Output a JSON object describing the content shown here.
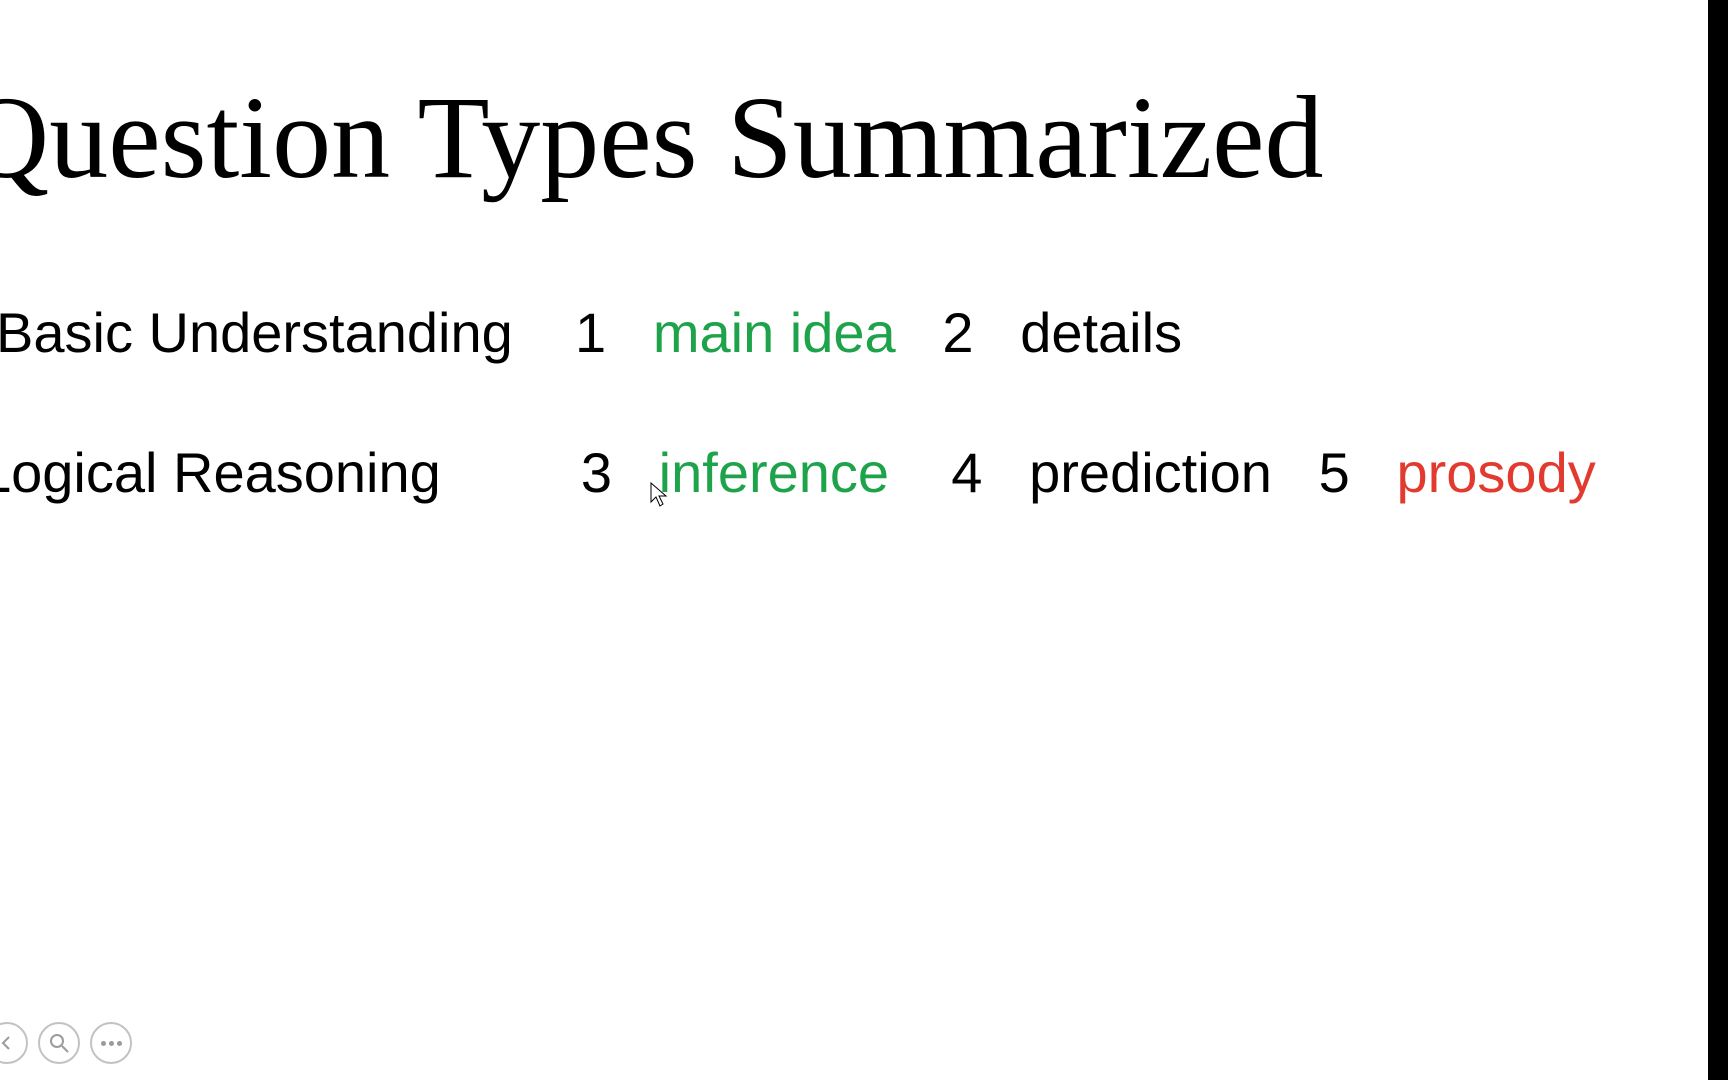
{
  "title": "Question Types Summarized",
  "line1": {
    "category": "Basic Understanding",
    "n1": "1",
    "t1": "main idea",
    "n2": "2",
    "t2": "details"
  },
  "line2": {
    "category": "Logical Reasoning",
    "n3": "3",
    "t3": "inference",
    "n4": "4",
    "t4": "prediction",
    "n5": "5",
    "t5": "prosody"
  },
  "colors": {
    "green": "#1ea34a",
    "red": "#e23a2f"
  }
}
